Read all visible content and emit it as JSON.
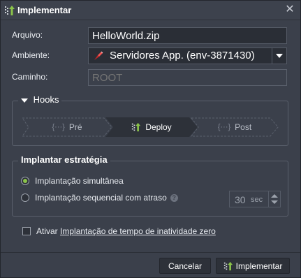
{
  "window": {
    "title": "Implementar",
    "close_icon": "close-icon"
  },
  "form": {
    "archive": {
      "label": "Arquivo:",
      "value": "HelloWorld.zip"
    },
    "environment": {
      "label": "Ambiente:",
      "value": "Servidores App. (env-3871430)"
    },
    "path": {
      "label": "Caminho:",
      "placeholder": "ROOT"
    }
  },
  "hooks": {
    "title": "Hooks",
    "steps": [
      {
        "label": "Pré",
        "icon": "{···}"
      },
      {
        "label": "Deploy",
        "icon": "deploy-icon",
        "active": true
      },
      {
        "label": "Post",
        "icon": "{···}"
      }
    ]
  },
  "strategy": {
    "title": "Implantar estratégia",
    "simultaneous": "Implantação simultânea",
    "sequential": "Implantação sequencial com atraso",
    "help": "?",
    "delay_value": "30",
    "delay_unit": "sec",
    "selected": "simultaneous"
  },
  "zero_downtime": {
    "prefix": "Ativar",
    "link": "Implantação de tempo de inatividade zero",
    "checked": false
  },
  "buttons": {
    "cancel": "Cancelar",
    "deploy": "Implementar"
  },
  "colors": {
    "accent_green": "#8bc34a",
    "background": "#3b404b",
    "field_bg": "#2a2e36"
  }
}
